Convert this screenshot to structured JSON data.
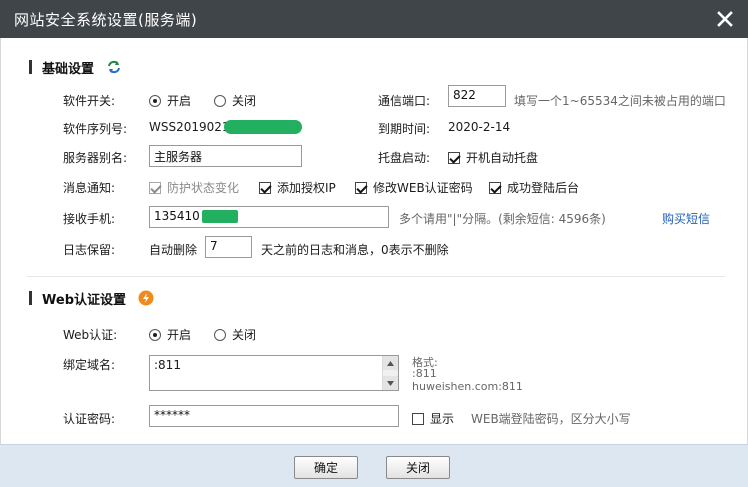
{
  "window": {
    "title": "网站安全系统设置(服务端)",
    "close_icon": "close-icon"
  },
  "basic": {
    "heading": "基础设置",
    "refresh_icon": "refresh-icon",
    "software_switch": {
      "label": "软件开关:",
      "on": "开启",
      "off": "关闭",
      "selected": "on"
    },
    "port": {
      "label": "通信端口:",
      "value": "822",
      "hint": "填写一个1~65534之间未被占用的端口"
    },
    "serial": {
      "label": "软件序列号:",
      "value": "WSS2019021"
    },
    "expire": {
      "label": "到期时间:",
      "value": "2020-2-14"
    },
    "server_alias": {
      "label": "服务器别名:",
      "value": "主服务器"
    },
    "tray": {
      "label": "托盘启动:",
      "option": "开机自动托盘",
      "checked": true
    },
    "notify": {
      "label": "消息通知:",
      "options": [
        {
          "text": "防护状态变化",
          "checked": true,
          "disabled": true
        },
        {
          "text": "添加授权IP",
          "checked": true,
          "disabled": false
        },
        {
          "text": "修改WEB认证密码",
          "checked": true,
          "disabled": false
        },
        {
          "text": "成功登陆后台",
          "checked": true,
          "disabled": false
        }
      ]
    },
    "phone": {
      "label": "接收手机:",
      "value": "135410",
      "hint": "多个请用\"|\"分隔。(剩余短信: 4596条)",
      "buy_link": "购买短信"
    },
    "log": {
      "label": "日志保留:",
      "prefix": "自动删除",
      "value": "7",
      "suffix": "天之前的日志和消息，0表示不删除"
    }
  },
  "web": {
    "heading": "Web认证设置",
    "info_icon": "lightning-icon",
    "auth": {
      "label": "Web认证:",
      "on": "开启",
      "off": "关闭",
      "selected": "on"
    },
    "domain": {
      "label": "绑定域名:",
      "value": ":811",
      "format_title": "格式:",
      "format_line1": ":811",
      "format_line2": "huweishen.com:811"
    },
    "password": {
      "label": "认证密码:",
      "value": "******",
      "show_label": "显示",
      "show_checked": false,
      "hint": "WEB端登陆密码，区分大小写"
    }
  },
  "footer": {
    "ok": "确定",
    "close": "关闭"
  },
  "colors": {
    "titlebar": "#404549",
    "footer": "#dde7f2",
    "link": "#1f5fb8",
    "redaction": "#22b060"
  }
}
